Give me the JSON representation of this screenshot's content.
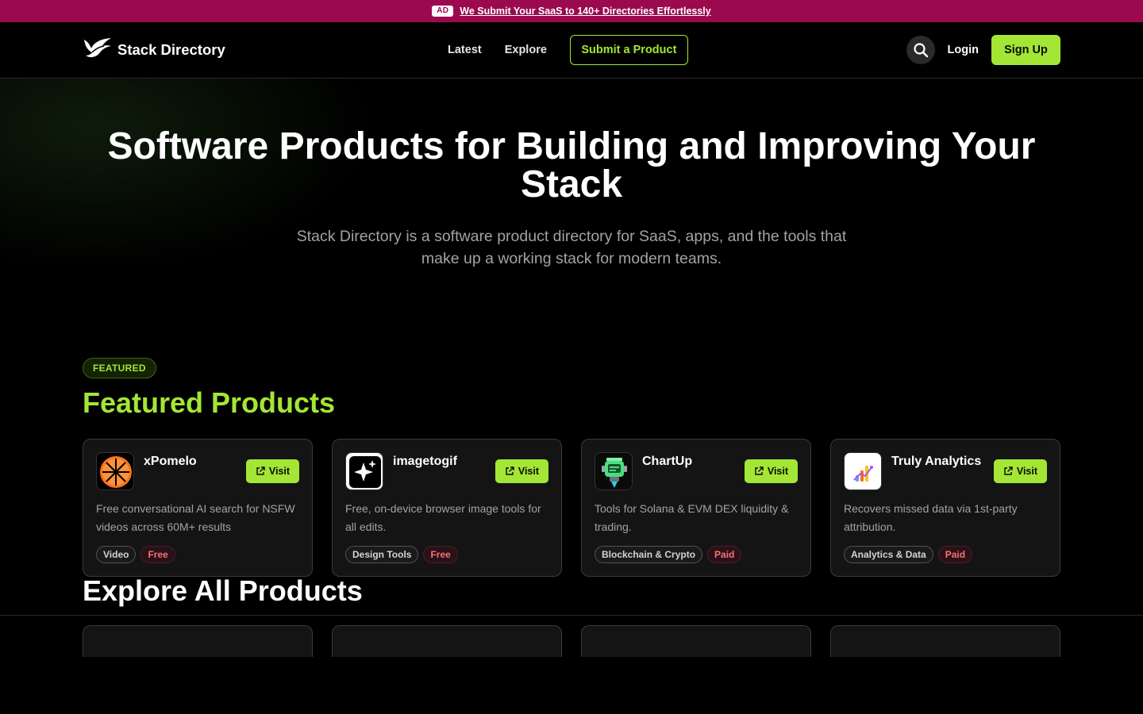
{
  "adbar": {
    "badge": "AD",
    "text": "We Submit Your SaaS to 140+ Directories Effortlessly"
  },
  "nav": {
    "logo_text": "Stack Directory",
    "links": [
      "Latest",
      "Explore"
    ],
    "submit_label": "Submit a Product",
    "login_label": "Login",
    "signup_label": "Sign Up"
  },
  "hero": {
    "title": "Software Products for Building and Improving Your Stack",
    "subtitle": "Stack Directory is a software product directory for SaaS, apps, and the tools that make up a working stack for modern teams."
  },
  "featured": {
    "badge": "FEATURED",
    "title": "Featured Products",
    "products": [
      {
        "name": "xPomelo",
        "visit": "Visit",
        "description": "Free conversational AI search for NSFW videos across 60M+ results",
        "category": "Video",
        "pricing": "Free",
        "logo_icon": "orange-slice-icon"
      },
      {
        "name": "imagetogif",
        "visit": "Visit",
        "description": "Free, on-device browser image tools for all edits.",
        "category": "Design Tools",
        "pricing": "Free",
        "logo_icon": "sparkle-icon"
      },
      {
        "name": "ChartUp",
        "visit": "Visit",
        "description": "Tools for Solana & EVM DEX liquidity & trading.",
        "category": "Blockchain & Crypto",
        "pricing": "Paid",
        "logo_icon": "robot-icon"
      },
      {
        "name": "Truly Analytics",
        "visit": "Visit",
        "description": "Recovers missed data via 1st-party attribution.",
        "category": "Analytics & Data",
        "pricing": "Paid",
        "logo_icon": "bar-chart-icon"
      }
    ]
  },
  "explore": {
    "title": "Explore All Products"
  },
  "colors": {
    "accent": "#a3e635",
    "ad_bar": "#9b0a4f",
    "background": "#000000"
  }
}
